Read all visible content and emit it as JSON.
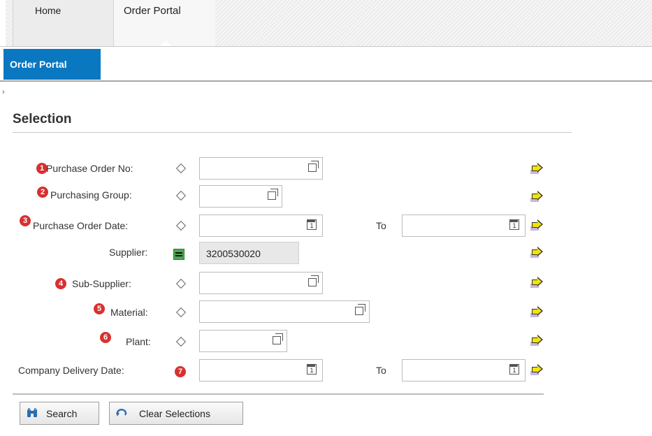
{
  "topnav": {
    "home_label": "Home",
    "order_portal_label": "Order Portal"
  },
  "subnav": {
    "active_tab": "Order Portal"
  },
  "section": {
    "title": "Selection"
  },
  "fields": {
    "po_no": {
      "label": "Purchase Order No:",
      "badge": "1"
    },
    "purch_group": {
      "label": "Purchasing Group:",
      "badge": "2"
    },
    "po_date": {
      "label": "Purchase Order Date:",
      "badge": "3",
      "to_label": "To"
    },
    "supplier": {
      "label": "Supplier:",
      "value": "3200530020"
    },
    "sub_supplier": {
      "label": "Sub-Supplier:",
      "badge": "4"
    },
    "material": {
      "label": "Material:",
      "badge": "5"
    },
    "plant": {
      "label": "Plant:",
      "badge": "6"
    },
    "delivery_date": {
      "label": "Company Delivery Date:",
      "badge": "7",
      "to_label": "To"
    }
  },
  "calendar_day": "1",
  "buttons": {
    "search": "Search",
    "clear": "Clear Selections"
  },
  "colors": {
    "accent": "#0a77c1",
    "badge": "#d83030",
    "go_arrow": "#f1e400",
    "equals_icon": "#4aa84f"
  }
}
